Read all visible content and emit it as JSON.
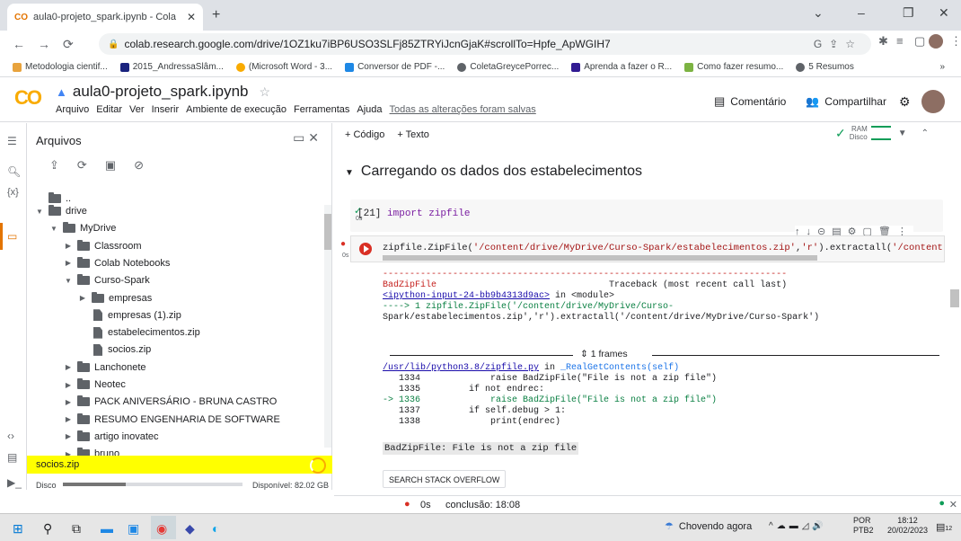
{
  "browser": {
    "tab_title": "aula0-projeto_spark.ipynb - Cola",
    "favicon": "CO",
    "new_tab": "+",
    "url": "colab.research.google.com/drive/1OZ1ku7iBP6USO3SLFj85ZTRYiJcnGjaK#scrollTo=Hpfe_ApWGIH7",
    "window_controls": [
      "⌄",
      "–",
      "❐",
      "✕"
    ]
  },
  "bookmarks": [
    "Metodologia cientif...",
    "2015_AndressaSlâm...",
    "(Microsoft Word - 3...",
    "Conversor de PDF -...",
    "ColetaGreycePorrec...",
    "Aprenda a fazer o R...",
    "Como fazer resumo...",
    "5 Resumos"
  ],
  "bookmark_more": "»",
  "colab": {
    "logo": "CO",
    "notebook_name": "aula0-projeto_spark.ipynb",
    "menu": [
      "Arquivo",
      "Editar",
      "Ver",
      "Inserir",
      "Ambiente de execução",
      "Ferramentas",
      "Ajuda"
    ],
    "saved_status": "Todas as alterações foram salvas",
    "comment_label": "Comentário",
    "share_label": "Compartilhar"
  },
  "file_panel": {
    "title": "Arquivos",
    "parent": "..",
    "tree": [
      {
        "label": "drive",
        "type": "folder",
        "depth": 0,
        "arrow": "▼"
      },
      {
        "label": "MyDrive",
        "type": "folder",
        "depth": 1,
        "arrow": "▼"
      },
      {
        "label": "Classroom",
        "type": "folder",
        "depth": 2,
        "arrow": "▶"
      },
      {
        "label": "Colab Notebooks",
        "type": "folder",
        "depth": 2,
        "arrow": "▶"
      },
      {
        "label": "Curso-Spark",
        "type": "folder",
        "depth": 2,
        "arrow": "▼"
      },
      {
        "label": "empresas",
        "type": "folder",
        "depth": 3,
        "arrow": "▶"
      },
      {
        "label": "empresas (1).zip",
        "type": "file",
        "depth": 3,
        "arrow": ""
      },
      {
        "label": "estabelecimentos.zip",
        "type": "file",
        "depth": 3,
        "arrow": ""
      },
      {
        "label": "socios.zip",
        "type": "file",
        "depth": 3,
        "arrow": ""
      },
      {
        "label": "Lanchonete",
        "type": "folder",
        "depth": 2,
        "arrow": "▶"
      },
      {
        "label": "Neotec",
        "type": "folder",
        "depth": 2,
        "arrow": "▶"
      },
      {
        "label": "PACK ANIVERSÁRIO - BRUNA CASTRO",
        "type": "folder",
        "depth": 2,
        "arrow": "▶"
      },
      {
        "label": "RESUMO ENGENHARIA DE SOFTWARE",
        "type": "folder",
        "depth": 2,
        "arrow": "▶"
      },
      {
        "label": "artigo inovatec",
        "type": "folder",
        "depth": 2,
        "arrow": "▶"
      },
      {
        "label": "bruno",
        "type": "folder",
        "depth": 2,
        "arrow": "▶"
      }
    ],
    "uploading_file": "socios.zip",
    "disk_label": "Disco",
    "disk_available": "Disponível: 82.02 GB",
    "disk_used_fraction": 0.35
  },
  "toolbar": {
    "add_code": "+ Código",
    "add_text": "+ Texto",
    "ram": "RAM",
    "disk": "Disco"
  },
  "notebook": {
    "section_title": "Carregando os dados dos estabelecimentos",
    "cell1": {
      "exec_count": "[21]",
      "code": "import zipfile",
      "time": "0s"
    },
    "cell2": {
      "time": "0s",
      "code_prefix": "zipfile.ZipFile(",
      "code_arg1": "'/content/drive/MyDrive/Curso-Spark/estabelecimentos.zip'",
      "code_mid": ",",
      "code_arg2": "'r'",
      "code_suffix": ").extractall(",
      "code_arg3": "'/content/driv"
    },
    "output": {
      "dashes": "---------------------------------------------------------------------------",
      "err_name": "BadZipFile",
      "traceback_hdr": "Traceback (most recent call last)",
      "input_link": "<ipython-input-24-bb9b4313d9ac>",
      "in_module": " in <module>",
      "arrow_line": "----> 1 zipfile.ZipFile('/content/drive/MyDrive/Curso-",
      "arrow_line2": "Spark/estabelecimentos.zip','r').extractall('/content/drive/MyDrive/Curso-Spark')",
      "frames": "1 frames",
      "lib_link": "/usr/lib/python3.8/zipfile.py",
      "lib_in": " in ",
      "lib_func": "_RealGetContents(self)",
      "src_lines": [
        "   1334             raise BadZipFile(\"File is not a zip file\")",
        "   1335         if not endrec:",
        "-> 1336             raise BadZipFile(\"File is not a zip file\")",
        "   1337         if self.debug > 1:",
        "   1338             print(endrec)"
      ],
      "final_error": "BadZipFile: File is not a zip file",
      "search_button": "SEARCH STACK OVERFLOW"
    }
  },
  "status_bar": {
    "time": "0s",
    "completion": "conclusão: 18:08"
  },
  "taskbar": {
    "weather": "Chovendo agora",
    "lang1": "POR",
    "lang2": "PTB2",
    "time": "18:12",
    "date": "20/02/2023",
    "notifications": "12"
  }
}
